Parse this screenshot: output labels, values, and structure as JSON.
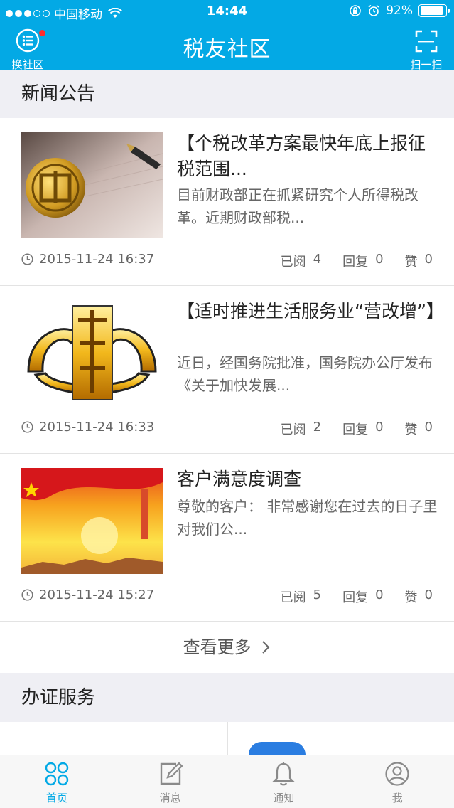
{
  "status_bar": {
    "carrier": "中国移动",
    "time": "14:44",
    "battery": "92%",
    "battery_level": 0.92
  },
  "navbar": {
    "title": "税友社区",
    "left_label": "换社区",
    "right_label": "扫一扫"
  },
  "news_section": {
    "title": "新闻公告",
    "items": [
      {
        "title": "【个税改革方案最快年底上报征税范围...",
        "summary": "目前财政部正在抓紧研究个人所得税改革。近期财政部税...",
        "date": "2015-11-24 16:37",
        "read_label": "已阅",
        "read_count": "4",
        "reply_label": "回复",
        "reply_count": "0",
        "like_label": "赞",
        "like_count": "0"
      },
      {
        "title": "【适时推进生活服务业“营改增”】",
        "summary": "近日，经国务院批准，国务院办公厅发布《关于加快发展...",
        "date": "2015-11-24 16:33",
        "read_label": "已阅",
        "read_count": "2",
        "reply_label": "回复",
        "reply_count": "0",
        "like_label": "赞",
        "like_count": "0"
      },
      {
        "title": "客户满意度调查",
        "summary": "尊敬的客户： 非常感谢您在过去的日子里对我们公...",
        "date": "2015-11-24 15:27",
        "read_label": "已阅",
        "read_count": "5",
        "reply_label": "回复",
        "reply_count": "0",
        "like_label": "赞",
        "like_count": "0"
      }
    ],
    "more_label": "查看更多"
  },
  "service_section": {
    "title": "办证服务"
  },
  "tabbar": {
    "tabs": [
      {
        "label": "首页",
        "icon": "home-grid-icon"
      },
      {
        "label": "消息",
        "icon": "edit-icon"
      },
      {
        "label": "通知",
        "icon": "bell-icon"
      },
      {
        "label": "我",
        "icon": "user-icon"
      }
    ]
  },
  "colors": {
    "brand": "#03a9e5",
    "badge": "#ff2d2d"
  }
}
